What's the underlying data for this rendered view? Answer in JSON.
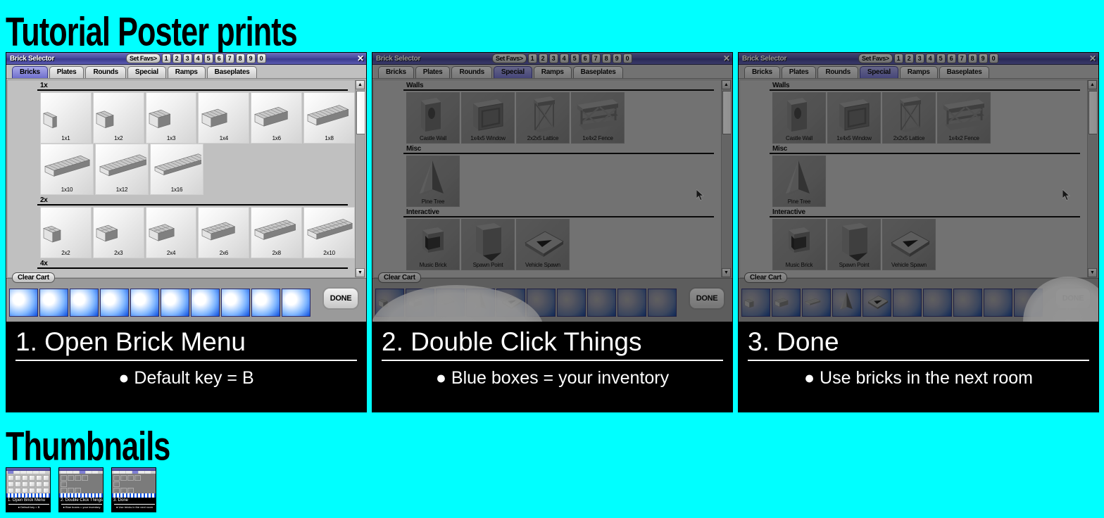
{
  "poster": {
    "title": "Tutorial Poster prints",
    "thumbnails_heading": "Thumbnails",
    "background_color": "#00FFFF"
  },
  "window_chrome": {
    "title": "Brick Selector",
    "set_favs_label": "Set Favs>",
    "fav_numbers": [
      "1",
      "2",
      "3",
      "4",
      "5",
      "6",
      "7",
      "8",
      "9",
      "0"
    ],
    "close_label": "✕",
    "tabs": [
      "Bricks",
      "Plates",
      "Rounds",
      "Special",
      "Ramps",
      "Baseplates"
    ],
    "clear_cart_label": "Clear Cart",
    "done_label": "DONE",
    "scroll_up_glyph": "▲",
    "scroll_down_glyph": "▼"
  },
  "panels": [
    {
      "id": "panel-1",
      "active_tab": "Bricks",
      "dimmed": false,
      "cart_filled": false,
      "cursor_visible": false,
      "highlight": null,
      "groups": [
        {
          "label": "1x",
          "items": [
            {
              "name": "1x1",
              "art": "cube1"
            },
            {
              "name": "1x2",
              "art": "cube2"
            },
            {
              "name": "1x3",
              "art": "cube3"
            },
            {
              "name": "1x4",
              "art": "cube4"
            },
            {
              "name": "1x6",
              "art": "cube6"
            },
            {
              "name": "1x8",
              "art": "cube8"
            }
          ]
        },
        {
          "label": "",
          "items": [
            {
              "name": "1x10",
              "art": "cube10"
            },
            {
              "name": "1x12",
              "art": "cube12"
            },
            {
              "name": "1x16",
              "art": "cube16"
            }
          ]
        },
        {
          "label": "2x",
          "items": [
            {
              "name": "2x2",
              "art": "brick2x2"
            },
            {
              "name": "2x3",
              "art": "brick2x3"
            },
            {
              "name": "2x4",
              "art": "brick2x4"
            },
            {
              "name": "2x6",
              "art": "brick2x6"
            },
            {
              "name": "2x8",
              "art": "brick2x8"
            },
            {
              "name": "2x10",
              "art": "brick2x10"
            }
          ]
        },
        {
          "label": "4x",
          "items": []
        }
      ],
      "caption": {
        "heading": "1. Open Brick Menu",
        "bullet": "● Default key = B"
      }
    },
    {
      "id": "panel-2",
      "active_tab": "Special",
      "dimmed": true,
      "cart_filled": true,
      "cursor_visible": true,
      "highlight": "cart",
      "groups": [
        {
          "label": "Walls",
          "items": [
            {
              "name": "Castle Wall",
              "art": "castlewall"
            },
            {
              "name": "1x4x5 Window",
              "art": "window"
            },
            {
              "name": "2x2x5 Lattice",
              "art": "lattice"
            },
            {
              "name": "1x4x2 Fence",
              "art": "fence"
            }
          ]
        },
        {
          "label": "Misc",
          "items": [
            {
              "name": "Pine Tree",
              "art": "pinetree"
            }
          ]
        },
        {
          "label": "Interactive",
          "items": [
            {
              "name": "Music Brick",
              "art": "musicbrick"
            },
            {
              "name": "Spawn Point",
              "art": "spawnpoint"
            },
            {
              "name": "Vehicle Spawn",
              "art": "vehiclespawn"
            }
          ]
        }
      ],
      "caption": {
        "heading": "2. Double Click Things",
        "bullet": "● Blue boxes = your inventory"
      }
    },
    {
      "id": "panel-3",
      "active_tab": "Special",
      "dimmed": true,
      "cart_filled": true,
      "cursor_visible": true,
      "highlight": "done",
      "groups": [
        {
          "label": "Walls",
          "items": [
            {
              "name": "Castle Wall",
              "art": "castlewall"
            },
            {
              "name": "1x4x5 Window",
              "art": "window"
            },
            {
              "name": "2x2x5 Lattice",
              "art": "lattice"
            },
            {
              "name": "1x4x2 Fence",
              "art": "fence"
            }
          ]
        },
        {
          "label": "Misc",
          "items": [
            {
              "name": "Pine Tree",
              "art": "pinetree"
            }
          ]
        },
        {
          "label": "Interactive",
          "items": [
            {
              "name": "Music Brick",
              "art": "musicbrick"
            },
            {
              "name": "Spawn Point",
              "art": "spawnpoint"
            },
            {
              "name": "Vehicle Spawn",
              "art": "vehiclespawn"
            }
          ]
        }
      ],
      "caption": {
        "heading": "3. Done",
        "bullet": "● Use bricks in the next room"
      }
    }
  ],
  "cart": {
    "slot_count": 10,
    "filled_items": [
      "brick2x2",
      "brick2x4",
      "plate",
      "pinetree",
      "vehiclespawn"
    ]
  },
  "thumbnails": [
    {
      "heading": "1. Open Brick Menu",
      "bullet": "● Default key = B",
      "dimmed": false
    },
    {
      "heading": "2. Double Click Things",
      "bullet": "● Blue boxes = your inventory",
      "dimmed": true
    },
    {
      "heading": "3. Done",
      "bullet": "● Use bricks in the next room",
      "dimmed": true
    }
  ]
}
